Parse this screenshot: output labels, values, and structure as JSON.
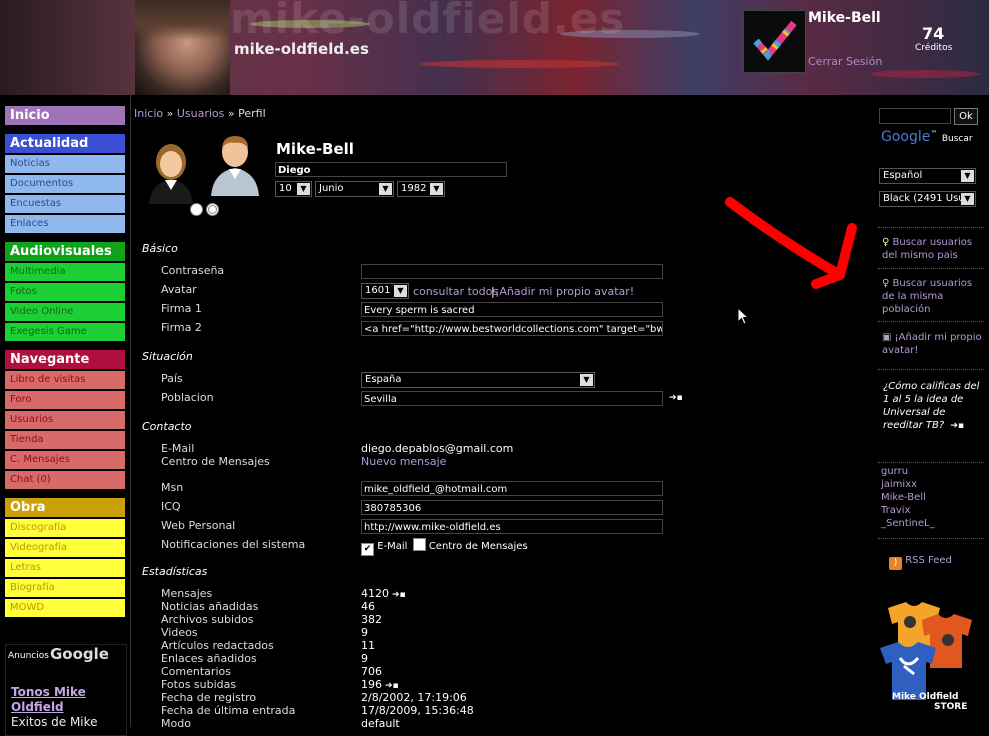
{
  "header": {
    "site_title": "mike-oldfield.es",
    "ghost_title": "mike-oldfield.es",
    "user_name": "Mike-Bell",
    "logout": "Cerrar Sesión",
    "credits_value": "74",
    "credits_label": "Créditos"
  },
  "left_menu": {
    "inicio": {
      "title": "Inicio"
    },
    "actualidad": {
      "title": "Actualidad",
      "items": [
        "Noticias",
        "Documentos",
        "Encuestas",
        "Enlaces"
      ]
    },
    "audiovisuales": {
      "title": "Audiovisuales",
      "items": [
        "Multimedia",
        "Fotos",
        "Video Online",
        "Exegesis Game"
      ]
    },
    "navegante": {
      "title": "Navegante",
      "items": [
        "Libro de visitas",
        "Foro",
        "Usuarios",
        "Tienda",
        "C. Mensajes",
        "Chat (0)"
      ]
    },
    "obra": {
      "title": "Obra",
      "items": [
        "Discografía",
        "Videografía",
        "Letras",
        "Biografía",
        "MOWD"
      ]
    },
    "ads": {
      "label": "Anuncios",
      "google": "Google",
      "link": "Tonos Mike Oldfield",
      "text": "Exitos de Mike"
    }
  },
  "breadcrumb": {
    "home": "Inicio",
    "users": "Usuarios",
    "current": "Perfil",
    "sep": "»"
  },
  "profile": {
    "name": "Mike-Bell",
    "first_name": "Diego",
    "birth_day": "10",
    "birth_month": "Junio",
    "birth_year": "1982",
    "sections": {
      "basic": "Básico",
      "situation": "Situación",
      "contact": "Contacto",
      "stats": "Estadísticas"
    },
    "basic": {
      "password_label": "Contraseña",
      "avatar_label": "Avatar",
      "avatar_value": "1601",
      "avatar_consult": "consultar todos",
      "avatar_pipe": "|",
      "avatar_add": "¡Añadir mi propio avatar!",
      "sig1_label": "Firma 1",
      "sig1_value": "Every sperm is sacred",
      "sig2_label": "Firma 2",
      "sig2_value": "<a href=\"http://www.bestworldcollections.com\" target=\"bwc\">"
    },
    "situation": {
      "country_label": "País",
      "country_value": "España",
      "city_label": "Poblacion",
      "city_value": "Sevilla"
    },
    "contact": {
      "email_label": "E-Mail",
      "email_value": "diego.depablos@gmail.com",
      "msg_center_label": "Centro de Mensajes",
      "msg_center_value": "Nuevo mensaje",
      "msn_label": "Msn",
      "msn_value": "mike_oldfield_@hotmail.com",
      "icq_label": "ICQ",
      "icq_value": "380785306",
      "web_label": "Web Personal",
      "web_value": "http://www.mike-oldfield.es",
      "notif_label": "Notificaciones del sistema",
      "notif_email": "E-Mail",
      "notif_center": "Centro de Mensajes"
    },
    "stats": [
      {
        "label": "Mensajes",
        "value": "4120",
        "icon": true
      },
      {
        "label": "Noticias añadidas",
        "value": "46"
      },
      {
        "label": "Archivos subidos",
        "value": "382"
      },
      {
        "label": "Videos",
        "value": "9"
      },
      {
        "label": "Artículos redactados",
        "value": "11"
      },
      {
        "label": "Enlaces añadidos",
        "value": "9"
      },
      {
        "label": "Comentarios",
        "value": "706"
      },
      {
        "label": "Fotos subidas",
        "value": "196",
        "icon": true
      },
      {
        "label": "Fecha de registro",
        "value": "2/8/2002, 17:19:06"
      },
      {
        "label": "Fecha de última entrada",
        "value": "17/8/2009, 15:36:48"
      },
      {
        "label": "Modo",
        "value": "default"
      }
    ]
  },
  "right": {
    "search_button": "Ok",
    "google": "Google",
    "google_tm": "™",
    "google_search": "Buscar",
    "language": "Español",
    "theme": "Black (2491 Usu",
    "links": [
      "Buscar usuarios del mismo pais",
      "Buscar usuarios de la misma población",
      "¡Añadir mi propio avatar!"
    ],
    "poll": "¿Cómo calificas del 1 al 5 la idea de Universal de reeditar TB?",
    "online_users": [
      "gurru",
      "jaimixx",
      "Mike-Bell",
      "Travix",
      "_SentineL_"
    ],
    "rss": "RSS Feed",
    "store_line1": "Mike Oldfield",
    "store_line2": "STORE"
  },
  "colors": {
    "accent_link": "#b59ad4",
    "annotation_arrow": "#ff0000"
  }
}
